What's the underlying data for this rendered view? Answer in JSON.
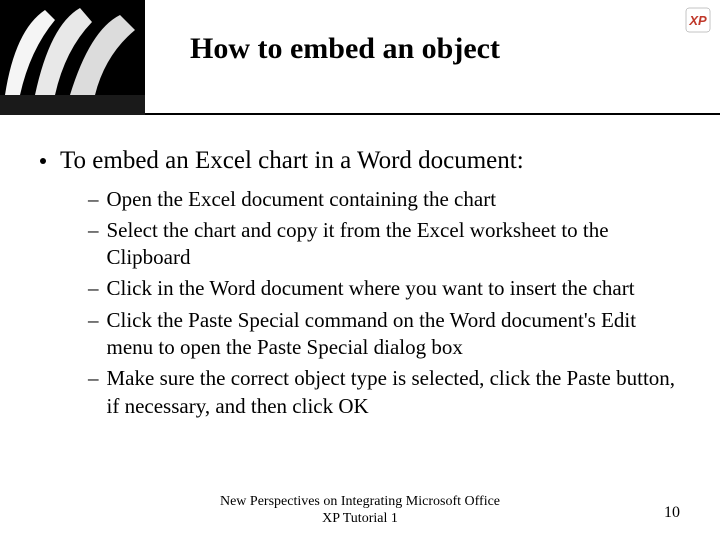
{
  "header": {
    "title": "How to embed an object",
    "badge_label": "XP"
  },
  "content": {
    "main_bullet": "To embed an Excel chart in a Word document:",
    "sub_bullets": [
      "Open the Excel document containing the chart",
      "Select the chart and copy it from the Excel worksheet to the Clipboard",
      "Click in the Word document where you want to insert the chart",
      "Click the Paste Special command on the Word document's Edit menu to open the Paste Special dialog box",
      "Make sure the correct object type is selected, click the Paste button, if necessary, and then click OK"
    ]
  },
  "footer": {
    "text": "New Perspectives on Integrating Microsoft Office XP Tutorial 1",
    "page": "10"
  }
}
